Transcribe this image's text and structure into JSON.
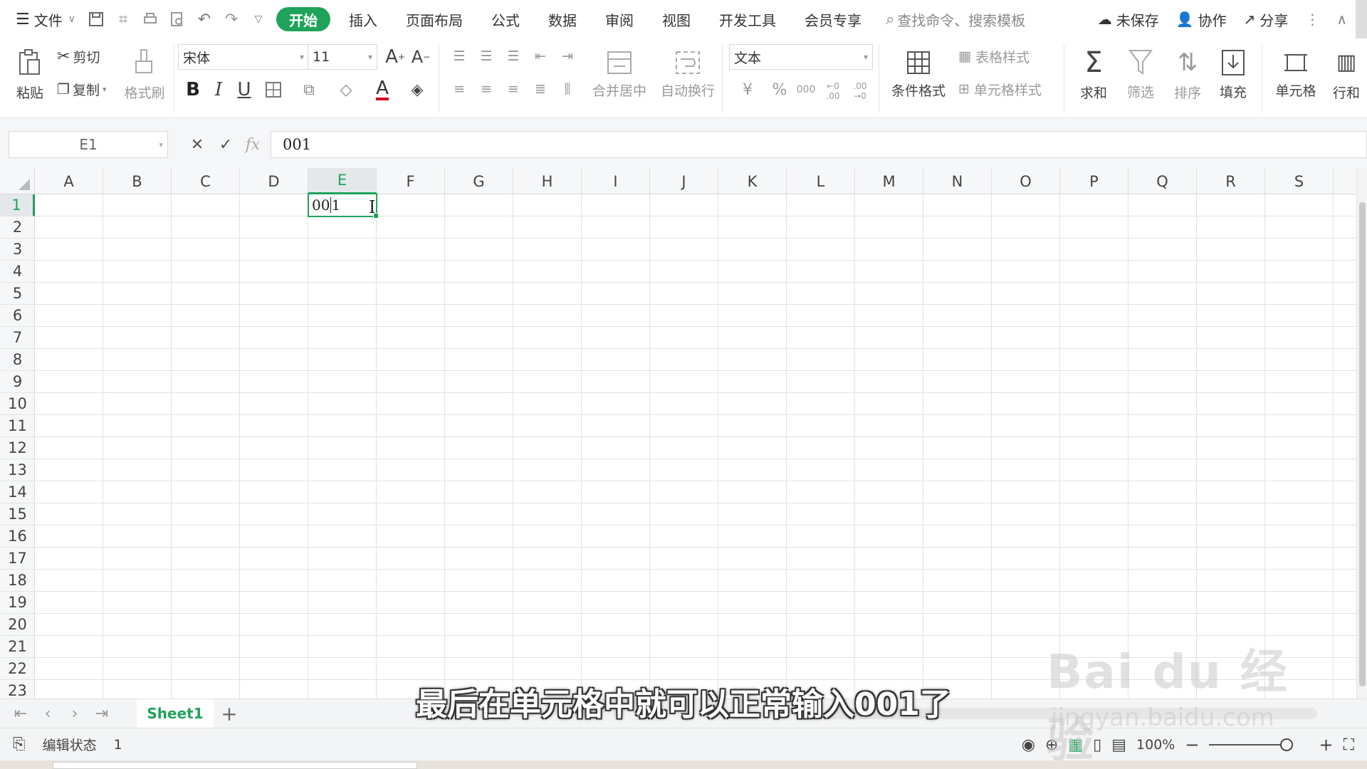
{
  "menubar": {
    "file_label": "文件",
    "tabs": [
      "开始",
      "插入",
      "页面布局",
      "公式",
      "数据",
      "审阅",
      "视图",
      "开发工具",
      "会员专享"
    ],
    "active_tab": "开始",
    "search_placeholder": "查找命令、搜索模板",
    "right_actions": {
      "unsaved": "未保存",
      "collaborate": "协作",
      "share": "分享"
    }
  },
  "ribbon": {
    "paste": "粘贴",
    "cut": "剪切",
    "copy": "复制",
    "format_painter": "格式刷",
    "font_name": "宋体",
    "font_size": "11",
    "bold": "B",
    "italic": "I",
    "underline": "U",
    "font_color_letter": "A",
    "merge_center": "合并居中",
    "wrap_text": "自动换行",
    "number_format": "文本",
    "currency": "¥",
    "percent": "%",
    "thousands": "000",
    "inc_decimal_top": "←0",
    "inc_decimal_bottom": ".00",
    "dec_decimal_top": ".00",
    "dec_decimal_bottom": "→0",
    "conditional_format": "条件格式",
    "table_style": "表格样式",
    "cell_style": "单元格样式",
    "sum": "求和",
    "filter": "筛选",
    "sort": "排序",
    "fill": "填充",
    "cell": "单元格",
    "row_col": "行和"
  },
  "formula_bar": {
    "name_box": "E1",
    "fx": "fx",
    "value": "001"
  },
  "grid": {
    "columns": [
      "A",
      "B",
      "C",
      "D",
      "E",
      "F",
      "G",
      "H",
      "I",
      "J",
      "K",
      "L",
      "M",
      "N",
      "O",
      "P",
      "Q",
      "R",
      "S"
    ],
    "rows": [
      "1",
      "2",
      "3",
      "4",
      "5",
      "6",
      "7",
      "8",
      "9",
      "10",
      "11",
      "12",
      "13",
      "14",
      "15",
      "16",
      "17",
      "18",
      "19",
      "20",
      "21",
      "22",
      "23"
    ],
    "selected_column": "E",
    "selected_row": "1",
    "active_cell_value_prefix": "00",
    "active_cell_value_suffix": "1"
  },
  "sheet_tabs": {
    "sheets": [
      "Sheet1"
    ],
    "active": "Sheet1",
    "add": "+"
  },
  "status_bar": {
    "mode": "编辑状态",
    "value": "1",
    "zoom": "100%"
  },
  "overlay": {
    "subtitle": "最后在单元格中就可以正常输入001了",
    "watermark_brand": "Bai du 经验",
    "watermark_url": "jingyan.baidu.com"
  },
  "colors": {
    "accent": "#1fa35a"
  }
}
